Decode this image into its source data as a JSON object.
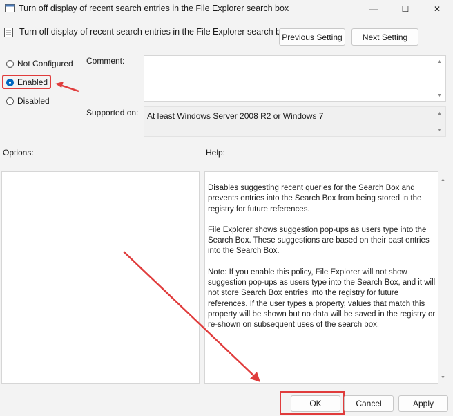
{
  "window": {
    "title": "Turn off display of recent search entries in the File Explorer search box",
    "controls": {
      "minimize": "—",
      "maximize": "☐",
      "close": "✕"
    }
  },
  "header": {
    "policy_title": "Turn off display of recent search entries in the File Explorer search box",
    "previous_button": "Previous Setting",
    "next_button": "Next Setting"
  },
  "state": {
    "options": [
      "Not Configured",
      "Enabled",
      "Disabled"
    ],
    "selected": "Enabled"
  },
  "comment": {
    "label": "Comment:",
    "value": ""
  },
  "supported": {
    "label": "Supported on:",
    "value": "At least Windows Server 2008 R2 or Windows 7"
  },
  "options_pane": {
    "label": "Options:"
  },
  "help_pane": {
    "label": "Help:",
    "paragraphs": [
      "Disables suggesting recent queries for the Search Box and prevents entries into the Search Box from being stored in the registry for future references.",
      "File Explorer shows suggestion pop-ups as users type into the Search Box.  These suggestions are based on their past entries into the Search Box.",
      "Note: If you enable this policy, File Explorer will not show suggestion pop-ups as users type into the Search Box, and it will not store Search Box entries into the registry for future references.  If the user types a property, values that match this property will be shown but no data will be saved in the registry or re-shown on subsequent uses of the search box."
    ]
  },
  "footer": {
    "ok": "OK",
    "cancel": "Cancel",
    "apply": "Apply"
  },
  "colors": {
    "highlight": "#e03c3c",
    "accent": "#0067c0"
  }
}
